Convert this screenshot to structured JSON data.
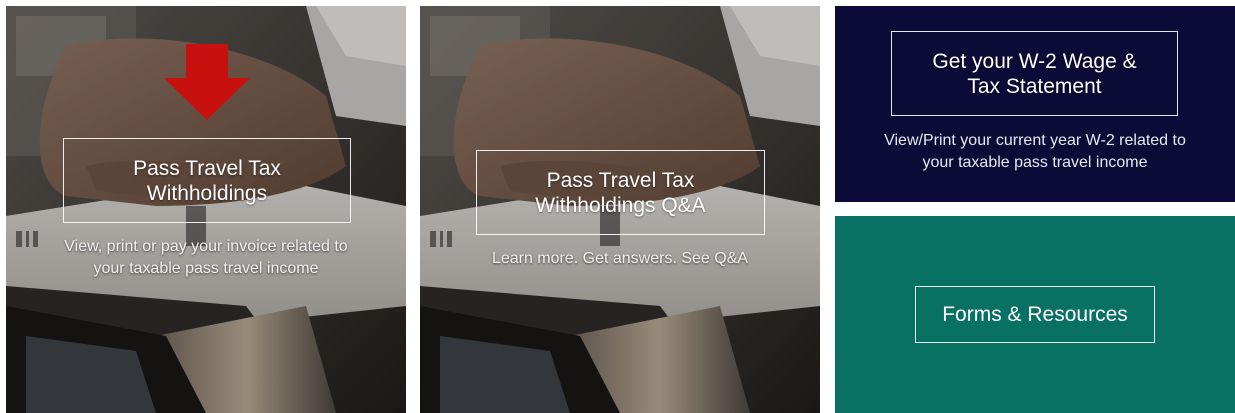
{
  "tiles": {
    "withholdings": {
      "title": "Pass Travel Tax\nWithholdings",
      "subtitle": "View, print or pay your invoice related to\nyour taxable pass travel income"
    },
    "qa": {
      "title": "Pass Travel Tax\nWithholdings Q&A",
      "subtitle": "Learn more. Get answers. See Q&A"
    },
    "w2": {
      "title": "Get your W-2 Wage &\nTax Statement",
      "subtitle": "View/Print your current year W-2 related to\nyour taxable pass travel income",
      "background": "#0c0a37"
    },
    "forms": {
      "title": "Forms & Resources",
      "background": "#087163"
    }
  },
  "icons": {
    "pointer": "down-arrow-icon"
  },
  "colors": {
    "arrow": "#c8100e",
    "navy": "#0c0a37",
    "teal": "#087163"
  }
}
